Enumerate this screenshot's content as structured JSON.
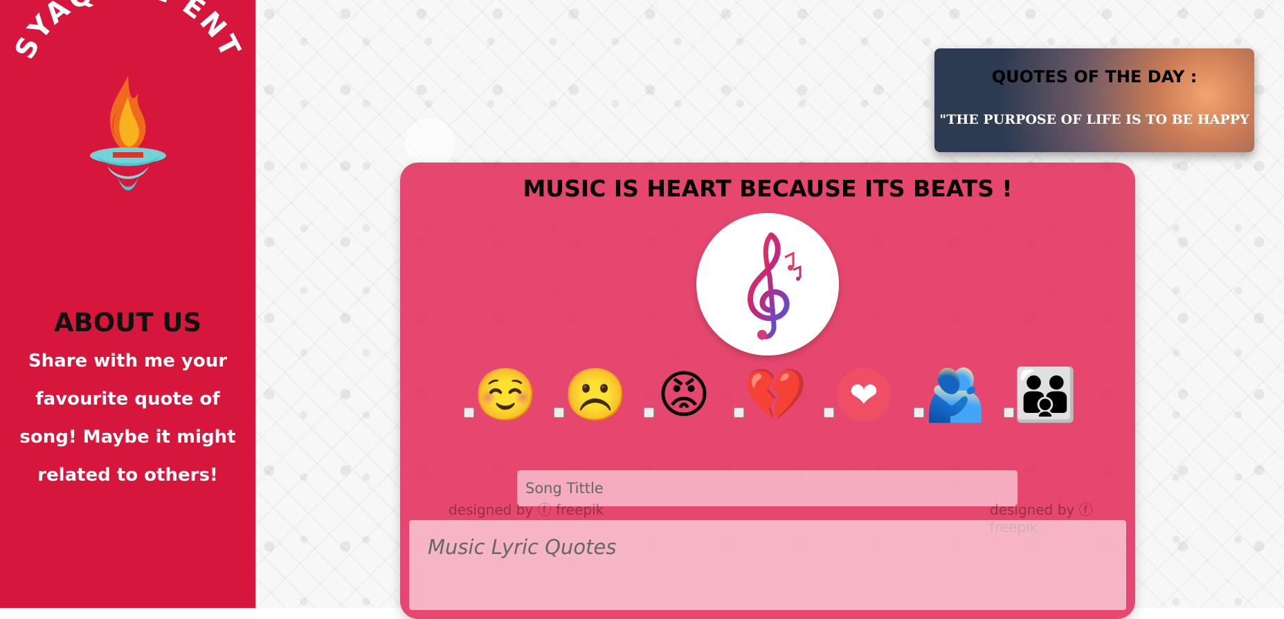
{
  "sidebar": {
    "brand": "SYAQOOL ENT",
    "about_title": "ABOUT US",
    "about_text": "Share with me your favourite quote of song! Maybe it might related to others!"
  },
  "quote_card": {
    "title": "QUOTES OF THE DAY :",
    "text": "\"THE PURPOSE OF LIFE IS TO BE HAPPY"
  },
  "main": {
    "headline": "MUSIC IS HEART BECAUSE ITS BEATS !",
    "clef_icon": "treble-clef-icon",
    "moods": [
      {
        "name": "smiling-blush",
        "glyph": "☺️"
      },
      {
        "name": "frowning",
        "glyph": "☹️"
      },
      {
        "name": "angry",
        "glyph": "😡"
      },
      {
        "name": "broken-heart",
        "glyph": "💔"
      },
      {
        "name": "heart",
        "glyph": "❤"
      },
      {
        "name": "couple-hugging",
        "glyph": "🫂"
      },
      {
        "name": "family",
        "glyph": "👪"
      }
    ],
    "song_title_placeholder": "Song Tittle",
    "lyric_placeholder": "Music Lyric Quotes",
    "watermark_left": "designed by ⓕ freepik",
    "watermark_right": "designed by ⓕ freepik"
  },
  "colors": {
    "sidebar": "#d7163c",
    "card": "#e42f5c"
  }
}
